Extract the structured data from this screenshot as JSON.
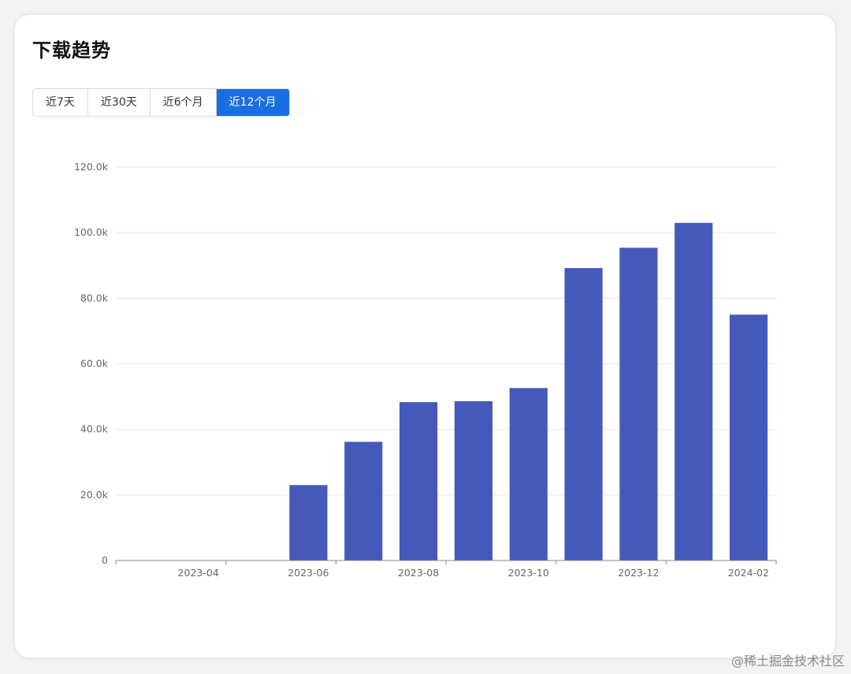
{
  "title": "下载趋势",
  "tabs": [
    {
      "label": "近7天",
      "active": false
    },
    {
      "label": "近30天",
      "active": false
    },
    {
      "label": "近6个月",
      "active": false
    },
    {
      "label": "近12个月",
      "active": true
    }
  ],
  "watermark": "@稀土掘金技术社区",
  "colors": {
    "bar": "#4459b9",
    "grid": "#e6e6e6",
    "axis": "#888888",
    "active_tab": "#1a6fe0"
  },
  "chart_data": {
    "type": "bar",
    "categories": [
      "2023-03",
      "2023-04",
      "2023-05",
      "2023-06",
      "2023-07",
      "2023-08",
      "2023-09",
      "2023-10",
      "2023-11",
      "2023-12",
      "2024-01",
      "2024-02"
    ],
    "values": [
      0,
      0,
      0,
      23000,
      36200,
      48300,
      48600,
      52600,
      89200,
      95400,
      103000,
      75000
    ],
    "x_tick_labels": [
      "2023-04",
      "2023-06",
      "2023-08",
      "2023-10",
      "2023-12",
      "2024-02"
    ],
    "y_ticks": [
      0,
      20000,
      40000,
      60000,
      80000,
      100000,
      120000
    ],
    "y_tick_labels": [
      "0",
      "20.0k",
      "40.0k",
      "60.0k",
      "80.0k",
      "100.0k",
      "120.0k"
    ],
    "ylim": [
      0,
      120000
    ],
    "grid": true,
    "title": "",
    "xlabel": "",
    "ylabel": ""
  }
}
